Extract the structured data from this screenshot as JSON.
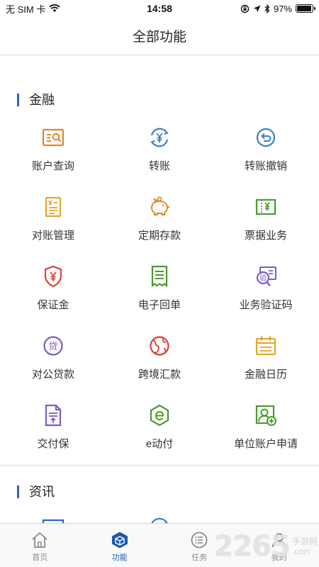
{
  "status": {
    "carrier": "无 SIM 卡",
    "time": "14:58",
    "battery": "97%",
    "battery_level": 0.97
  },
  "nav": {
    "title": "全部功能"
  },
  "sections": {
    "finance": {
      "title": "金融",
      "items": [
        {
          "label": "账户查询",
          "icon": "account-query-icon"
        },
        {
          "label": "转账",
          "icon": "transfer-icon"
        },
        {
          "label": "转账撤销",
          "icon": "transfer-revoke-icon"
        },
        {
          "label": "对账管理",
          "icon": "reconciliation-icon"
        },
        {
          "label": "定期存款",
          "icon": "piggy-bank-icon"
        },
        {
          "label": "票据业务",
          "icon": "bill-icon"
        },
        {
          "label": "保证金",
          "icon": "shield-yen-icon"
        },
        {
          "label": "电子回单",
          "icon": "receipt-icon"
        },
        {
          "label": "业务验证码",
          "icon": "verify-code-icon"
        },
        {
          "label": "对公贷款",
          "icon": "loan-icon"
        },
        {
          "label": "跨境汇款",
          "icon": "globe-icon"
        },
        {
          "label": "金融日历",
          "icon": "calendar-icon"
        },
        {
          "label": "交付保",
          "icon": "document-icon"
        },
        {
          "label": "e动付",
          "icon": "e-pay-icon"
        },
        {
          "label": "单位账户申请",
          "icon": "account-apply-icon"
        }
      ]
    },
    "news": {
      "title": "资讯",
      "items": [
        {
          "label": "",
          "icon": "chart-icon"
        },
        {
          "label": "",
          "icon": "exchange-rate-icon"
        }
      ]
    }
  },
  "tabs": [
    {
      "label": "首页",
      "icon": "home-icon",
      "active": false
    },
    {
      "label": "功能",
      "icon": "cube-icon",
      "active": true
    },
    {
      "label": "任务",
      "icon": "task-list-icon",
      "active": false
    },
    {
      "label": "我的",
      "icon": "user-icon",
      "active": false
    }
  ],
  "watermark": {
    "number": "2265",
    "text_1": "手游网",
    "text_2": ".com"
  },
  "colors": {
    "accent": "#2c63c9",
    "active_tab": "#1a5cab",
    "orange": "#e0862b",
    "blue": "#3a7fc9",
    "gold": "#e3a52a",
    "green": "#4a9b2e",
    "red": "#d9413a",
    "purple": "#7a5cc4"
  }
}
